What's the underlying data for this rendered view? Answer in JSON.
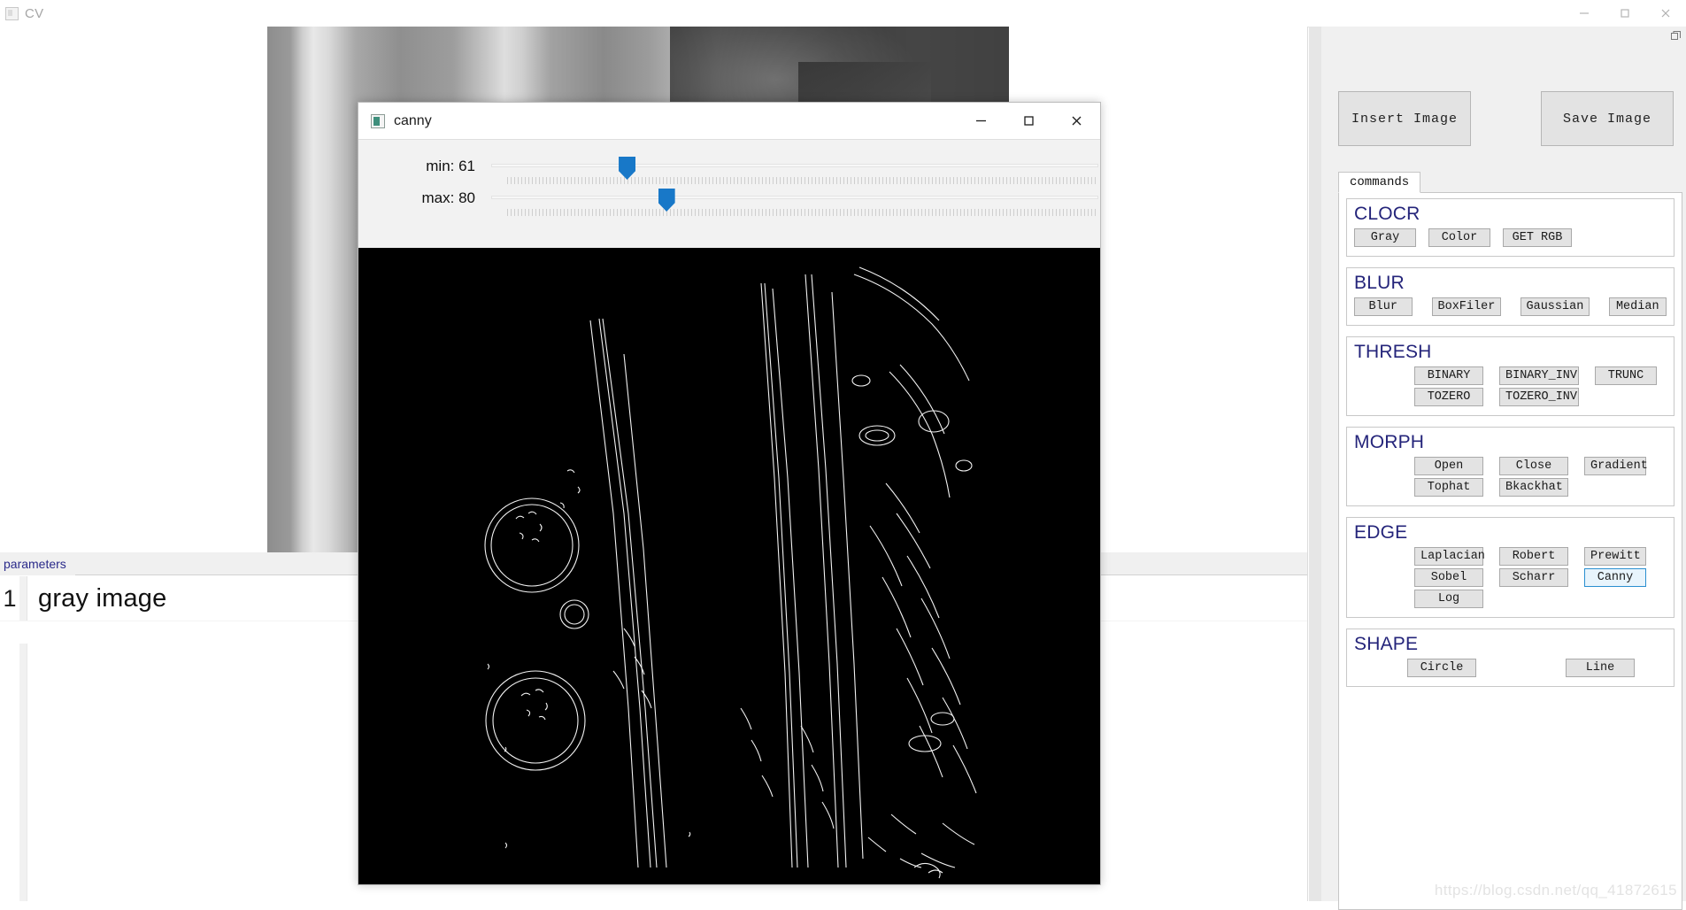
{
  "main_window": {
    "title": "CV",
    "controls": {
      "minimize": "minimize-icon",
      "maximize": "maximize-icon",
      "close": "close-icon"
    }
  },
  "viewer": {
    "scroll_up": "chevron-up-icon",
    "scroll_down": "chevron-down-icon"
  },
  "parameters_pane": {
    "tab_label": "parameters",
    "rows": [
      {
        "index": "1",
        "label": "gray image"
      }
    ]
  },
  "right_dock": {
    "insert_image_label": "Insert Image",
    "save_image_label": "Save Image",
    "tab_label": "commands",
    "float_icon": "restore-icon",
    "groups": [
      {
        "id": "clocr",
        "title": "CLOCR",
        "rows": [
          [
            {
              "label": "Gray",
              "width": "w70",
              "focused": false
            },
            {
              "label": "Color",
              "width": "w70",
              "focused": false
            },
            {
              "label": "GET RGB",
              "width": "w78",
              "focused": false
            }
          ]
        ]
      },
      {
        "id": "blur",
        "title": "BLUR",
        "rows": [
          [
            {
              "label": "Blur",
              "width": "w70",
              "focused": false
            },
            {
              "label": "BoxFiler",
              "width": "w78",
              "focused": false
            },
            {
              "label": "Gaussian",
              "width": "w78",
              "focused": false
            },
            {
              "label": "Median",
              "width": "w70",
              "focused": false
            }
          ]
        ]
      },
      {
        "id": "thresh",
        "title": "THRESH",
        "rows": [
          [
            {
              "label": "BINARY",
              "width": "w78",
              "focused": false
            },
            {
              "label": "BINARY_INV",
              "width": "w90",
              "focused": false
            },
            {
              "label": "TRUNC",
              "width": "w70",
              "focused": false
            }
          ],
          [
            {
              "label": "TOZERO",
              "width": "w78",
              "focused": false
            },
            {
              "label": "TOZERO_INV",
              "width": "w90",
              "focused": false
            }
          ]
        ]
      },
      {
        "id": "morph",
        "title": "MORPH",
        "rows": [
          [
            {
              "label": "Open",
              "width": "w78",
              "focused": false
            },
            {
              "label": "Close",
              "width": "w78",
              "focused": false
            },
            {
              "label": "Gradient",
              "width": "w70",
              "focused": false
            }
          ],
          [
            {
              "label": "Tophat",
              "width": "w78",
              "focused": false
            },
            {
              "label": "Bkackhat",
              "width": "w78",
              "focused": false
            }
          ]
        ]
      },
      {
        "id": "edge",
        "title": "EDGE",
        "rows": [
          [
            {
              "label": "Laplacian",
              "width": "w78",
              "focused": false
            },
            {
              "label": "Robert",
              "width": "w78",
              "focused": false
            },
            {
              "label": "Prewitt",
              "width": "w70",
              "focused": false
            }
          ],
          [
            {
              "label": "Sobel",
              "width": "w78",
              "focused": false
            },
            {
              "label": "Scharr",
              "width": "w78",
              "focused": false
            },
            {
              "label": "Canny",
              "width": "w70",
              "focused": true
            }
          ],
          [
            {
              "label": "Log",
              "width": "w78",
              "focused": false
            }
          ]
        ]
      },
      {
        "id": "shape",
        "title": "SHAPE",
        "rows": [
          [
            {
              "label": "Circle",
              "width": "w78",
              "focused": false
            },
            {
              "label": "Line",
              "width": "w78",
              "focused": false
            }
          ]
        ]
      }
    ]
  },
  "canny_dialog": {
    "title": "canny",
    "app_icon": "opencv-window-icon",
    "controls": {
      "minimize": "minimize-icon",
      "maximize": "maximize-icon",
      "close": "close-icon"
    },
    "sliders": [
      {
        "name": "min",
        "label": "min: 61",
        "value": 61,
        "max": 255,
        "handle_percent": 21.0
      },
      {
        "name": "max",
        "label": "max: 80",
        "value": 80,
        "max": 255,
        "handle_percent": 27.5
      }
    ]
  },
  "watermark": {
    "text": "https://blog.csdn.net/qq_41872615"
  },
  "colors": {
    "accent_blue": "#1878c8",
    "group_title": "#24247a",
    "focus_border": "#2a8fd0",
    "focus_fill": "#e8f4fc",
    "button_face": "#e3e3e3",
    "dock_bg": "#f0f0f0"
  }
}
